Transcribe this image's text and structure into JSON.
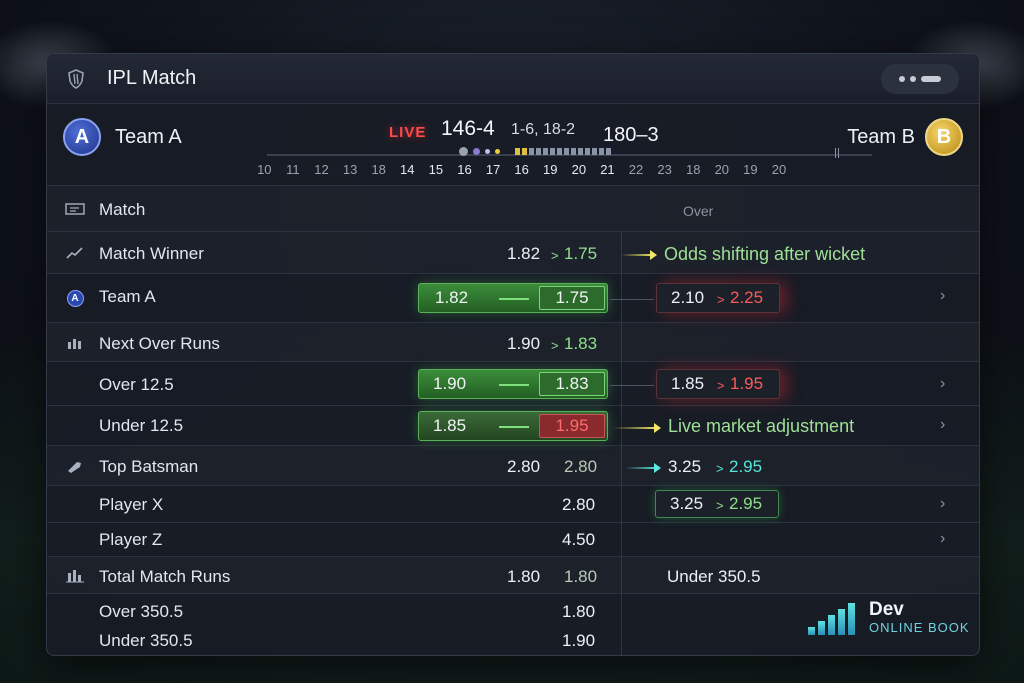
{
  "window": {
    "title": "IPL Match"
  },
  "header": {
    "team_a": {
      "name": "Team A",
      "badge": "A"
    },
    "team_b": {
      "name": "Team B",
      "badge": "B"
    },
    "live_label": "LIVE",
    "score_main": "146-4",
    "score_sub": "1-6, 18-2",
    "score_b": "180–3",
    "overs": [
      "10",
      "11",
      "12",
      "13",
      "18",
      "14",
      "15",
      "16",
      "17",
      "16",
      "19",
      "20",
      "21",
      "22",
      "23",
      "18",
      "20",
      "19",
      "20"
    ]
  },
  "table": {
    "section_label": "Match",
    "over_column": "Over"
  },
  "markets": {
    "match_winner": {
      "label": "Match Winner",
      "old": "1.82",
      "new": "1.75",
      "note": "Odds shifting after wicket"
    },
    "team_a_row": {
      "label": "Team A",
      "old": "1.82",
      "new": "1.75",
      "right_old": "2.10",
      "right_new": "2.25"
    },
    "next_over": {
      "label": "Next Over Runs",
      "old": "1.90",
      "new": "1.83"
    },
    "over_12_5": {
      "label": "Over 12.5",
      "old": "1.90",
      "new": "1.83",
      "right_old": "1.85",
      "right_new": "1.95"
    },
    "under_12_5": {
      "label": "Under 12.5",
      "old": "1.85",
      "new": "1.95",
      "note": "Live market adjustment"
    },
    "top_batsman": {
      "label": "Top Batsman",
      "old": "2.80",
      "new": "2.80",
      "right_old": "3.25",
      "right_new": "2.95"
    },
    "player_x": {
      "label": "Player X",
      "value": "2.80",
      "right_old": "3.25",
      "right_new": "2.95"
    },
    "player_z": {
      "label": "Player Z",
      "value": "4.50"
    },
    "total_runs": {
      "label": "Total Match Runs",
      "old": "1.80",
      "new": "1.80",
      "right_label": "Under 350.5"
    },
    "over_350": {
      "label": "Over 350.5",
      "value": "1.80"
    },
    "under_350": {
      "label": "Under 350.5",
      "value": "1.90"
    }
  },
  "symbols": {
    "change_arrow": ">",
    "chevron": "›"
  },
  "watermark": {
    "line1": "Dev",
    "line2": "ONLINE BOOK"
  },
  "colors": {
    "up": "#8fe08a",
    "down": "#ff5a5a",
    "live": "#ff4a4a",
    "accent_cyan": "#55e6d8"
  }
}
